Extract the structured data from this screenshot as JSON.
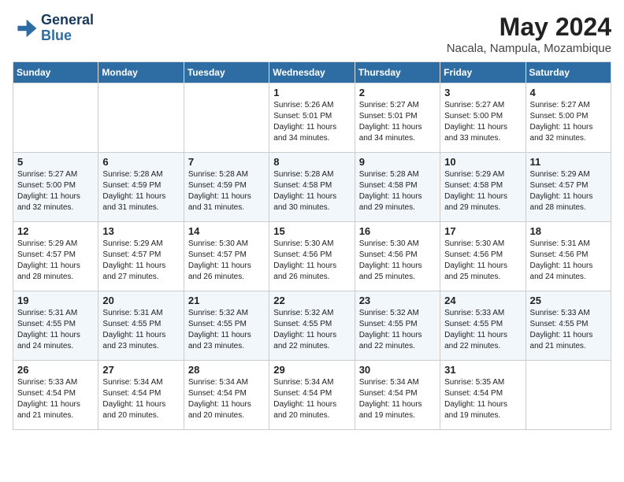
{
  "header": {
    "logo_line1": "General",
    "logo_line2": "Blue",
    "month_year": "May 2024",
    "location": "Nacala, Nampula, Mozambique"
  },
  "weekdays": [
    "Sunday",
    "Monday",
    "Tuesday",
    "Wednesday",
    "Thursday",
    "Friday",
    "Saturday"
  ],
  "weeks": [
    [
      {
        "day": "",
        "info": ""
      },
      {
        "day": "",
        "info": ""
      },
      {
        "day": "",
        "info": ""
      },
      {
        "day": "1",
        "info": "Sunrise: 5:26 AM\nSunset: 5:01 PM\nDaylight: 11 hours and 34 minutes."
      },
      {
        "day": "2",
        "info": "Sunrise: 5:27 AM\nSunset: 5:01 PM\nDaylight: 11 hours and 34 minutes."
      },
      {
        "day": "3",
        "info": "Sunrise: 5:27 AM\nSunset: 5:00 PM\nDaylight: 11 hours and 33 minutes."
      },
      {
        "day": "4",
        "info": "Sunrise: 5:27 AM\nSunset: 5:00 PM\nDaylight: 11 hours and 32 minutes."
      }
    ],
    [
      {
        "day": "5",
        "info": "Sunrise: 5:27 AM\nSunset: 5:00 PM\nDaylight: 11 hours and 32 minutes."
      },
      {
        "day": "6",
        "info": "Sunrise: 5:28 AM\nSunset: 4:59 PM\nDaylight: 11 hours and 31 minutes."
      },
      {
        "day": "7",
        "info": "Sunrise: 5:28 AM\nSunset: 4:59 PM\nDaylight: 11 hours and 31 minutes."
      },
      {
        "day": "8",
        "info": "Sunrise: 5:28 AM\nSunset: 4:58 PM\nDaylight: 11 hours and 30 minutes."
      },
      {
        "day": "9",
        "info": "Sunrise: 5:28 AM\nSunset: 4:58 PM\nDaylight: 11 hours and 29 minutes."
      },
      {
        "day": "10",
        "info": "Sunrise: 5:29 AM\nSunset: 4:58 PM\nDaylight: 11 hours and 29 minutes."
      },
      {
        "day": "11",
        "info": "Sunrise: 5:29 AM\nSunset: 4:57 PM\nDaylight: 11 hours and 28 minutes."
      }
    ],
    [
      {
        "day": "12",
        "info": "Sunrise: 5:29 AM\nSunset: 4:57 PM\nDaylight: 11 hours and 28 minutes."
      },
      {
        "day": "13",
        "info": "Sunrise: 5:29 AM\nSunset: 4:57 PM\nDaylight: 11 hours and 27 minutes."
      },
      {
        "day": "14",
        "info": "Sunrise: 5:30 AM\nSunset: 4:57 PM\nDaylight: 11 hours and 26 minutes."
      },
      {
        "day": "15",
        "info": "Sunrise: 5:30 AM\nSunset: 4:56 PM\nDaylight: 11 hours and 26 minutes."
      },
      {
        "day": "16",
        "info": "Sunrise: 5:30 AM\nSunset: 4:56 PM\nDaylight: 11 hours and 25 minutes."
      },
      {
        "day": "17",
        "info": "Sunrise: 5:30 AM\nSunset: 4:56 PM\nDaylight: 11 hours and 25 minutes."
      },
      {
        "day": "18",
        "info": "Sunrise: 5:31 AM\nSunset: 4:56 PM\nDaylight: 11 hours and 24 minutes."
      }
    ],
    [
      {
        "day": "19",
        "info": "Sunrise: 5:31 AM\nSunset: 4:55 PM\nDaylight: 11 hours and 24 minutes."
      },
      {
        "day": "20",
        "info": "Sunrise: 5:31 AM\nSunset: 4:55 PM\nDaylight: 11 hours and 23 minutes."
      },
      {
        "day": "21",
        "info": "Sunrise: 5:32 AM\nSunset: 4:55 PM\nDaylight: 11 hours and 23 minutes."
      },
      {
        "day": "22",
        "info": "Sunrise: 5:32 AM\nSunset: 4:55 PM\nDaylight: 11 hours and 22 minutes."
      },
      {
        "day": "23",
        "info": "Sunrise: 5:32 AM\nSunset: 4:55 PM\nDaylight: 11 hours and 22 minutes."
      },
      {
        "day": "24",
        "info": "Sunrise: 5:33 AM\nSunset: 4:55 PM\nDaylight: 11 hours and 22 minutes."
      },
      {
        "day": "25",
        "info": "Sunrise: 5:33 AM\nSunset: 4:55 PM\nDaylight: 11 hours and 21 minutes."
      }
    ],
    [
      {
        "day": "26",
        "info": "Sunrise: 5:33 AM\nSunset: 4:54 PM\nDaylight: 11 hours and 21 minutes."
      },
      {
        "day": "27",
        "info": "Sunrise: 5:34 AM\nSunset: 4:54 PM\nDaylight: 11 hours and 20 minutes."
      },
      {
        "day": "28",
        "info": "Sunrise: 5:34 AM\nSunset: 4:54 PM\nDaylight: 11 hours and 20 minutes."
      },
      {
        "day": "29",
        "info": "Sunrise: 5:34 AM\nSunset: 4:54 PM\nDaylight: 11 hours and 20 minutes."
      },
      {
        "day": "30",
        "info": "Sunrise: 5:34 AM\nSunset: 4:54 PM\nDaylight: 11 hours and 19 minutes."
      },
      {
        "day": "31",
        "info": "Sunrise: 5:35 AM\nSunset: 4:54 PM\nDaylight: 11 hours and 19 minutes."
      },
      {
        "day": "",
        "info": ""
      }
    ]
  ]
}
